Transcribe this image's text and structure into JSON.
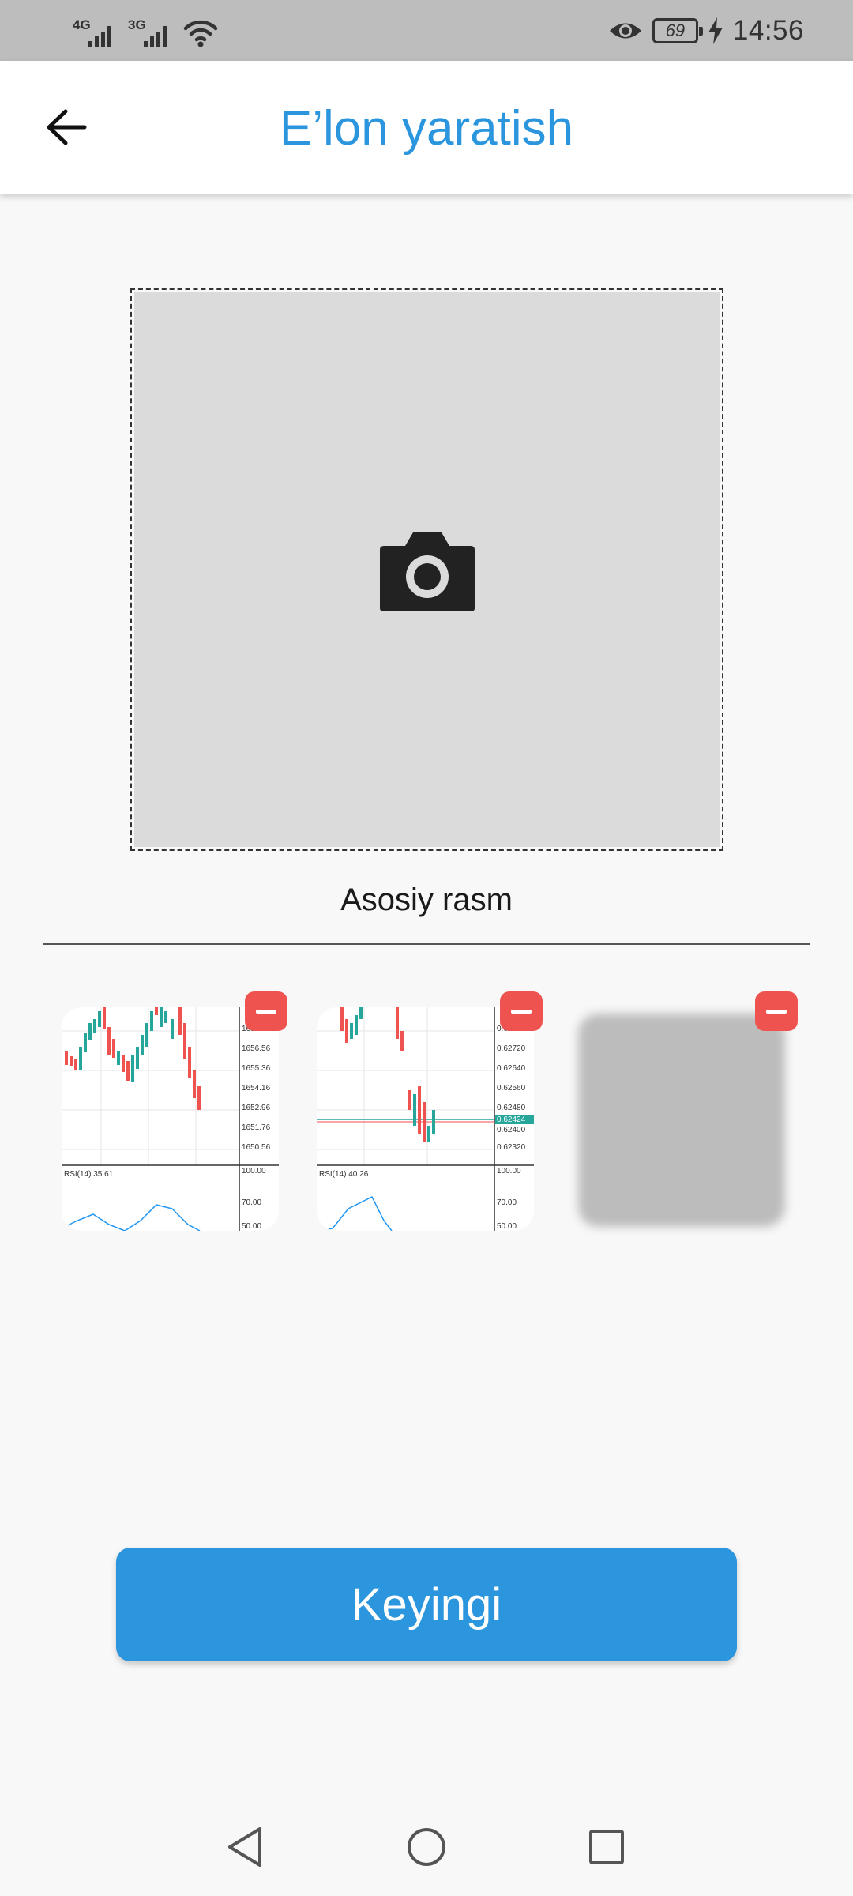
{
  "status_bar": {
    "sim1_network": "4G",
    "sim2_network": "3G",
    "battery_level": "69",
    "time": "14:56",
    "icons": [
      "signal-icon",
      "signal-icon",
      "wifi-icon",
      "eye-icon",
      "battery-icon",
      "charging-icon"
    ]
  },
  "header": {
    "title": "E’lon yaratish",
    "back_icon": "arrow-back-icon"
  },
  "main_image": {
    "icon": "camera-icon",
    "label": "Asosiy rasm"
  },
  "thumbnails": [
    {
      "kind": "chart-screenshot",
      "rsi_label": "RSI(14) 35.61",
      "prices": [
        "1657.78",
        "1656.56",
        "1655.36",
        "1654.16",
        "1652.96",
        "1651.76",
        "1650.56"
      ],
      "rsi_levels": [
        "100.00",
        "70.00",
        "50.00"
      ],
      "remove_icon": "minus-icon"
    },
    {
      "kind": "chart-screenshot",
      "rsi_label": "RSI(14) 40.26",
      "prices": [
        "0.62800",
        "0.62720",
        "0.62640",
        "0.62560",
        "0.62480",
        "0.62400",
        "0.62320"
      ],
      "current_price": "0.62424",
      "rsi_levels": [
        "100.00",
        "70.00",
        "50.00"
      ],
      "remove_icon": "minus-icon"
    },
    {
      "kind": "placeholder",
      "remove_icon": "minus-icon"
    }
  ],
  "actions": {
    "next_label": "Keyingi"
  },
  "nav_bar": {
    "icons": [
      "nav-back-icon",
      "nav-home-icon",
      "nav-recents-icon"
    ]
  },
  "colors": {
    "accent": "#2b96de",
    "remove": "#ef5350",
    "candle_up": "#26a69a",
    "candle_down": "#ef5350",
    "rsi_line": "#2196f3"
  }
}
